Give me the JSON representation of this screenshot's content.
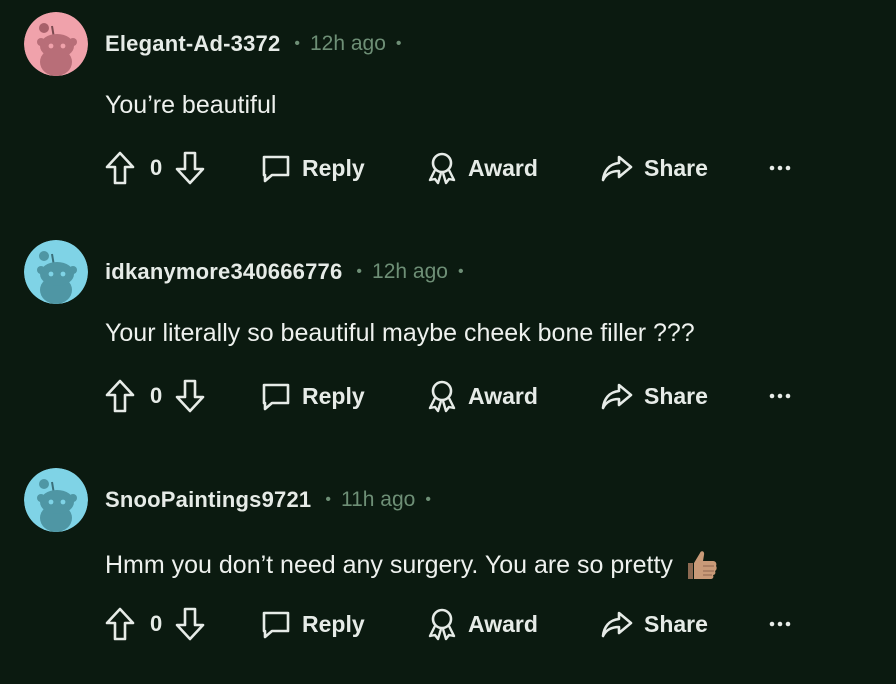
{
  "colors": {
    "background": "#0b1a10",
    "meta_text": "#6e8f76",
    "avatar_pink": "#f0a2ab",
    "avatar_teal": "#7fd3e6"
  },
  "comments": [
    {
      "username": "Elegant-Ad-3372",
      "time": "12h ago",
      "text": "You’re beautiful",
      "votes": "0",
      "avatar_color": "#f0a2ab",
      "emoji": ""
    },
    {
      "username": "idkanymore340666776",
      "time": "12h ago",
      "text": "Your literally so beautiful maybe cheek bone filler ???",
      "votes": "0",
      "avatar_color": "#7fd3e6",
      "emoji": ""
    },
    {
      "username": "SnooPaintings9721",
      "time": "11h ago",
      "text": "Hmm you don’t need any surgery. You are so pretty",
      "votes": "0",
      "avatar_color": "#7fd3e6",
      "emoji": "thumbs-up-icon"
    }
  ],
  "actions": {
    "reply_label": "Reply",
    "award_label": "Award",
    "share_label": "Share",
    "more_label": "···"
  },
  "icons": {
    "upvote": "arrow-up-icon",
    "downvote": "arrow-down-icon",
    "reply": "speech-bubble-icon",
    "award": "award-ribbon-icon",
    "share": "share-arrow-icon",
    "more": "ellipsis-icon"
  }
}
